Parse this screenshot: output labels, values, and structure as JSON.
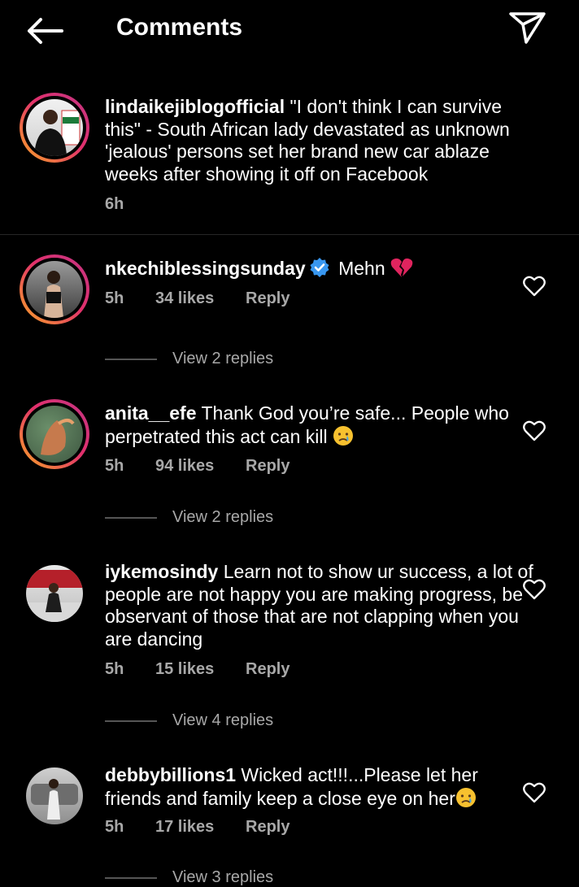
{
  "header": {
    "title": "Comments"
  },
  "caption": {
    "username": "lindaikejiblogofficial",
    "text": "\"I don't think I can survive this\" - South African lady devastated as unknown 'jealous' persons set her brand new car ablaze weeks after showing it off on Facebook",
    "time": "6h"
  },
  "comments": [
    {
      "username": "nkechiblessingsunday",
      "text": "Mehn",
      "time": "5h",
      "likes": "34 likes",
      "reply": "Reply",
      "replies": "View 2 replies"
    },
    {
      "username": "anita__efe",
      "text": "Thank God you’re safe... People who perpetrated this act can kill",
      "time": "5h",
      "likes": "94 likes",
      "reply": "Reply",
      "replies": "View 2 replies"
    },
    {
      "username": "iykemosindy",
      "text": "Learn not to show ur success, a lot of people are not happy you are making progress, be observant of those that are not clapping when you are dancing",
      "time": "5h",
      "likes": "15 likes",
      "reply": "Reply",
      "replies": "View 4 replies"
    },
    {
      "username": "debbybillions1",
      "text": "Wicked act!!!...Please let her friends and family keep a close eye on her",
      "time": "5h",
      "likes": "17 likes",
      "reply": "Reply",
      "replies": "View 3 replies"
    }
  ],
  "icons": {
    "back": "arrow-left-icon",
    "send": "paper-plane-icon",
    "heart": "heart-outline-icon",
    "verified": "verified-badge-icon",
    "broken_heart": "broken-heart-emoji",
    "crying": "crying-face-emoji"
  },
  "colors": {
    "background": "#000000",
    "muted": "#a8a8a8",
    "verified": "#3897f0",
    "divider": "#262626"
  }
}
